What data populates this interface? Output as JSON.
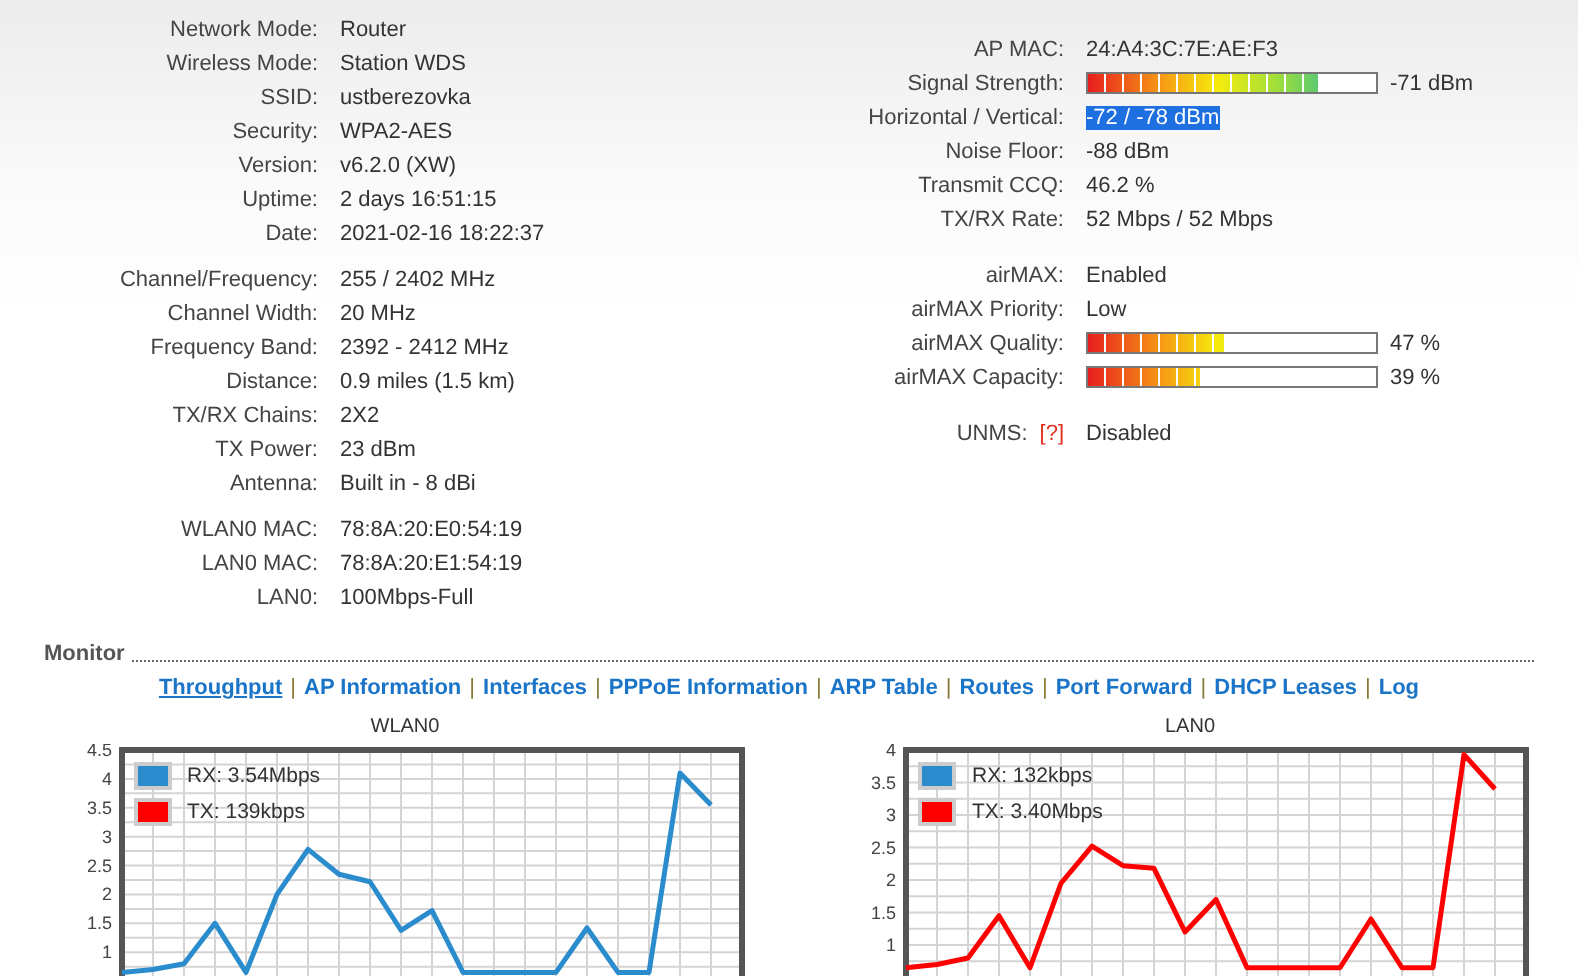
{
  "device_info": {
    "groups": [
      [
        {
          "label": "Network Mode:",
          "value": "Router"
        },
        {
          "label": "Wireless Mode:",
          "value": "Station WDS"
        },
        {
          "label": "SSID:",
          "value": "ustberezovka"
        },
        {
          "label": "Security:",
          "value": "WPA2-AES"
        },
        {
          "label": "Version:",
          "value": "v6.2.0 (XW)"
        },
        {
          "label": "Uptime:",
          "value": "2 days 16:51:15"
        },
        {
          "label": "Date:",
          "value": "2021-02-16 18:22:37"
        }
      ],
      [
        {
          "label": "Channel/Frequency:",
          "value": "255 / 2402 MHz"
        },
        {
          "label": "Channel Width:",
          "value": "20 MHz"
        },
        {
          "label": "Frequency Band:",
          "value": "2392 - 2412 MHz"
        },
        {
          "label": "Distance:",
          "value": "0.9 miles (1.5 km)"
        },
        {
          "label": "TX/RX Chains:",
          "value": "2X2"
        },
        {
          "label": "TX Power:",
          "value": "23 dBm"
        },
        {
          "label": "Antenna:",
          "value": "Built in - 8 dBi"
        }
      ],
      [
        {
          "label": "WLAN0 MAC:",
          "value": "78:8A:20:E0:54:19"
        },
        {
          "label": "LAN0 MAC:",
          "value": "78:8A:20:E1:54:19"
        },
        {
          "label": "LAN0:",
          "value": "100Mbps-Full"
        }
      ]
    ]
  },
  "status": {
    "groups": [
      [
        {
          "kind": "text",
          "label": "AP MAC:",
          "value": "24:A4:3C:7E:AE:F3",
          "highlighted": false
        },
        {
          "kind": "bar",
          "label": "Signal Strength:",
          "level": 0.8,
          "value": "-71 dBm",
          "highlighted": false
        },
        {
          "kind": "text",
          "label": "Horizontal / Vertical:",
          "value": "-72 / -78 dBm",
          "highlighted": true
        },
        {
          "kind": "text",
          "label": "Noise Floor:",
          "value": "-88 dBm",
          "highlighted": false
        },
        {
          "kind": "text",
          "label": "Transmit CCQ:",
          "value": "46.2 %",
          "highlighted": false
        },
        {
          "kind": "text",
          "label": "TX/RX Rate:",
          "value": "52 Mbps / 52 Mbps",
          "highlighted": false
        }
      ],
      [
        {
          "kind": "text",
          "label": "airMAX:",
          "value": "Enabled",
          "highlighted": false
        },
        {
          "kind": "text",
          "label": "airMAX Priority:",
          "value": "Low",
          "highlighted": false
        },
        {
          "kind": "bar",
          "label": "airMAX Quality:",
          "level": 0.47,
          "value": "47 %",
          "highlighted": false
        },
        {
          "kind": "bar",
          "label": "airMAX Capacity:",
          "level": 0.39,
          "value": "39 %",
          "highlighted": false
        }
      ],
      [
        {
          "kind": "help",
          "label": "UNMS:",
          "help": "[?]",
          "value": "Disabled",
          "highlighted": false
        }
      ]
    ]
  },
  "monitor": {
    "title": "Monitor",
    "separator": "|",
    "tabs": [
      {
        "label": "Throughput",
        "selected": true
      },
      {
        "label": "AP Information",
        "selected": false
      },
      {
        "label": "Interfaces",
        "selected": false
      },
      {
        "label": "PPPoE Information",
        "selected": false
      },
      {
        "label": "ARP Table",
        "selected": false
      },
      {
        "label": "Routes",
        "selected": false
      },
      {
        "label": "Port Forward",
        "selected": false
      },
      {
        "label": "DHCP Leases",
        "selected": false
      },
      {
        "label": "Log",
        "selected": false
      }
    ],
    "charts": [
      {
        "chart_data": {
          "type": "line",
          "title": "WLAN0",
          "grid": true,
          "categories": [
            null,
            null,
            null,
            null,
            null,
            null,
            null,
            null,
            null,
            null,
            null,
            null,
            null,
            null,
            null,
            null,
            null,
            null,
            null,
            null
          ],
          "ylim": [
            0,
            4.5
          ],
          "yticks": [
            1,
            1.5,
            2,
            2.5,
            3,
            3.5,
            4,
            4.5
          ],
          "series": [
            {
              "name": "RX: 3.54Mbps",
              "color": "#2a8ccc",
              "values": [
                0.65,
                0.7,
                0.8,
                1.5,
                0.65,
                2.0,
                2.78,
                2.35,
                2.22,
                1.38,
                1.72,
                0.65,
                0.65,
                0.65,
                0.65,
                1.42,
                0.65,
                0.65,
                4.1,
                3.55
              ]
            },
            {
              "name": "TX: 139kbps",
              "color": "#ff0000",
              "values": [
                null,
                null,
                null,
                null,
                null,
                null,
                null,
                null,
                null,
                null,
                null,
                null,
                null,
                null,
                null,
                null,
                null,
                null,
                null,
                null
              ]
            }
          ]
        }
      },
      {
        "chart_data": {
          "type": "line",
          "title": "LAN0",
          "grid": true,
          "categories": [
            null,
            null,
            null,
            null,
            null,
            null,
            null,
            null,
            null,
            null,
            null,
            null,
            null,
            null,
            null,
            null,
            null,
            null,
            null,
            null
          ],
          "ylim": [
            0,
            4
          ],
          "yticks": [
            1,
            1.5,
            2,
            2.5,
            3,
            3.5,
            4
          ],
          "series": [
            {
              "name": "RX: 132kbps",
              "color": "#2a8ccc",
              "values": [
                null,
                null,
                null,
                null,
                null,
                null,
                null,
                null,
                null,
                null,
                null,
                null,
                null,
                null,
                null,
                null,
                null,
                null,
                null,
                null
              ]
            },
            {
              "name": "TX: 3.40Mbps",
              "color": "#ff0000",
              "values": [
                0.65,
                0.7,
                0.8,
                1.45,
                0.65,
                1.95,
                2.52,
                2.22,
                2.18,
                1.2,
                1.7,
                0.65,
                0.65,
                0.65,
                0.65,
                1.4,
                0.65,
                0.65,
                3.93,
                3.4
              ]
            }
          ]
        }
      }
    ]
  }
}
